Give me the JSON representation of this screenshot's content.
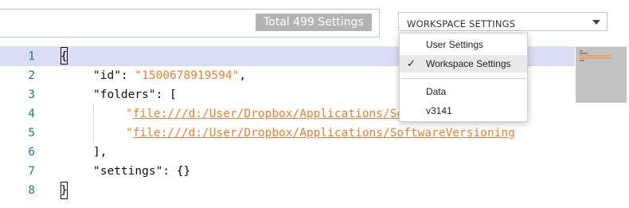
{
  "header": {
    "count_badge": "Total 499 Settings",
    "scope_select_value": "WORKSPACE SETTINGS"
  },
  "dropdown": {
    "items": [
      {
        "label": "User Settings",
        "checked": false
      },
      {
        "label": "Workspace Settings",
        "checked": true
      },
      {
        "label": "Data",
        "checked": false
      },
      {
        "label": "v3141",
        "checked": false
      }
    ],
    "check_glyph": "✓"
  },
  "editor": {
    "line_numbers": [
      "1",
      "2",
      "3",
      "4",
      "5",
      "6",
      "7",
      "8"
    ],
    "lines": {
      "l1_open": "{",
      "l2_key": "\"id\"",
      "l2_colon": ": ",
      "l2_value": "\"1500678919594\"",
      "l2_comma": ",",
      "l3_key": "\"folders\"",
      "l3_rest": ": [",
      "l4_quote": "\"",
      "l4_link": "file:///d:/User/Dropbox/Applications/SoftwareVersioning",
      "l5_quote": "\"",
      "l5_link": "file:///d:/User/Dropbox/Applications/SoftwareVersioning",
      "l6_close": "],",
      "l7_key": "\"settings\"",
      "l7_rest": ": {}",
      "l8_close": "}"
    },
    "highlight_color": "#d9dcf5",
    "string_color": "#ee7e2e",
    "line_number_color": "#237893"
  }
}
